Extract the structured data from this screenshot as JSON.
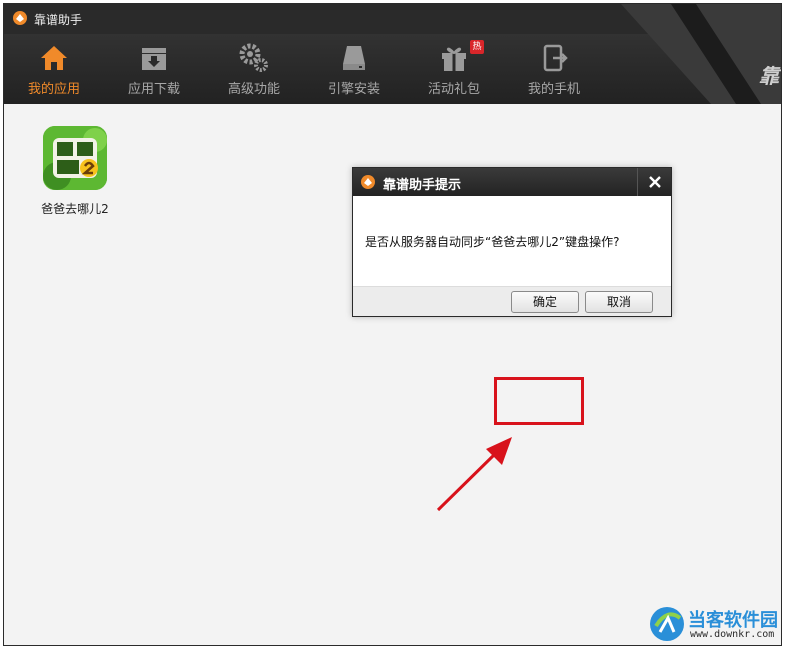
{
  "window": {
    "title": "靠谱助手"
  },
  "nav": [
    {
      "label": "我的应用",
      "icon": "home-icon",
      "active": true
    },
    {
      "label": "应用下载",
      "icon": "download-box-icon",
      "active": false
    },
    {
      "label": "高级功能",
      "icon": "gears-icon",
      "active": false
    },
    {
      "label": "引擎安装",
      "icon": "hard-drive-icon",
      "active": false
    },
    {
      "label": "活动礼包",
      "icon": "gift-icon",
      "active": false,
      "badge": "热"
    },
    {
      "label": "我的手机",
      "icon": "phone-exit-icon",
      "active": false
    }
  ],
  "brand_partial": "靠",
  "apps": [
    {
      "name": "爸爸去哪儿2"
    }
  ],
  "dialog": {
    "title": "靠谱助手提示",
    "message": "是否从服务器自动同步“爸爸去哪儿2”键盘操作?",
    "ok_label": "确定",
    "cancel_label": "取消"
  },
  "watermark": {
    "title": "当客软件园",
    "url": "www.downkr.com"
  },
  "colors": {
    "accent": "#f08a2a",
    "titlebar": "#2a2a2a",
    "highlight": "#d8121b"
  }
}
